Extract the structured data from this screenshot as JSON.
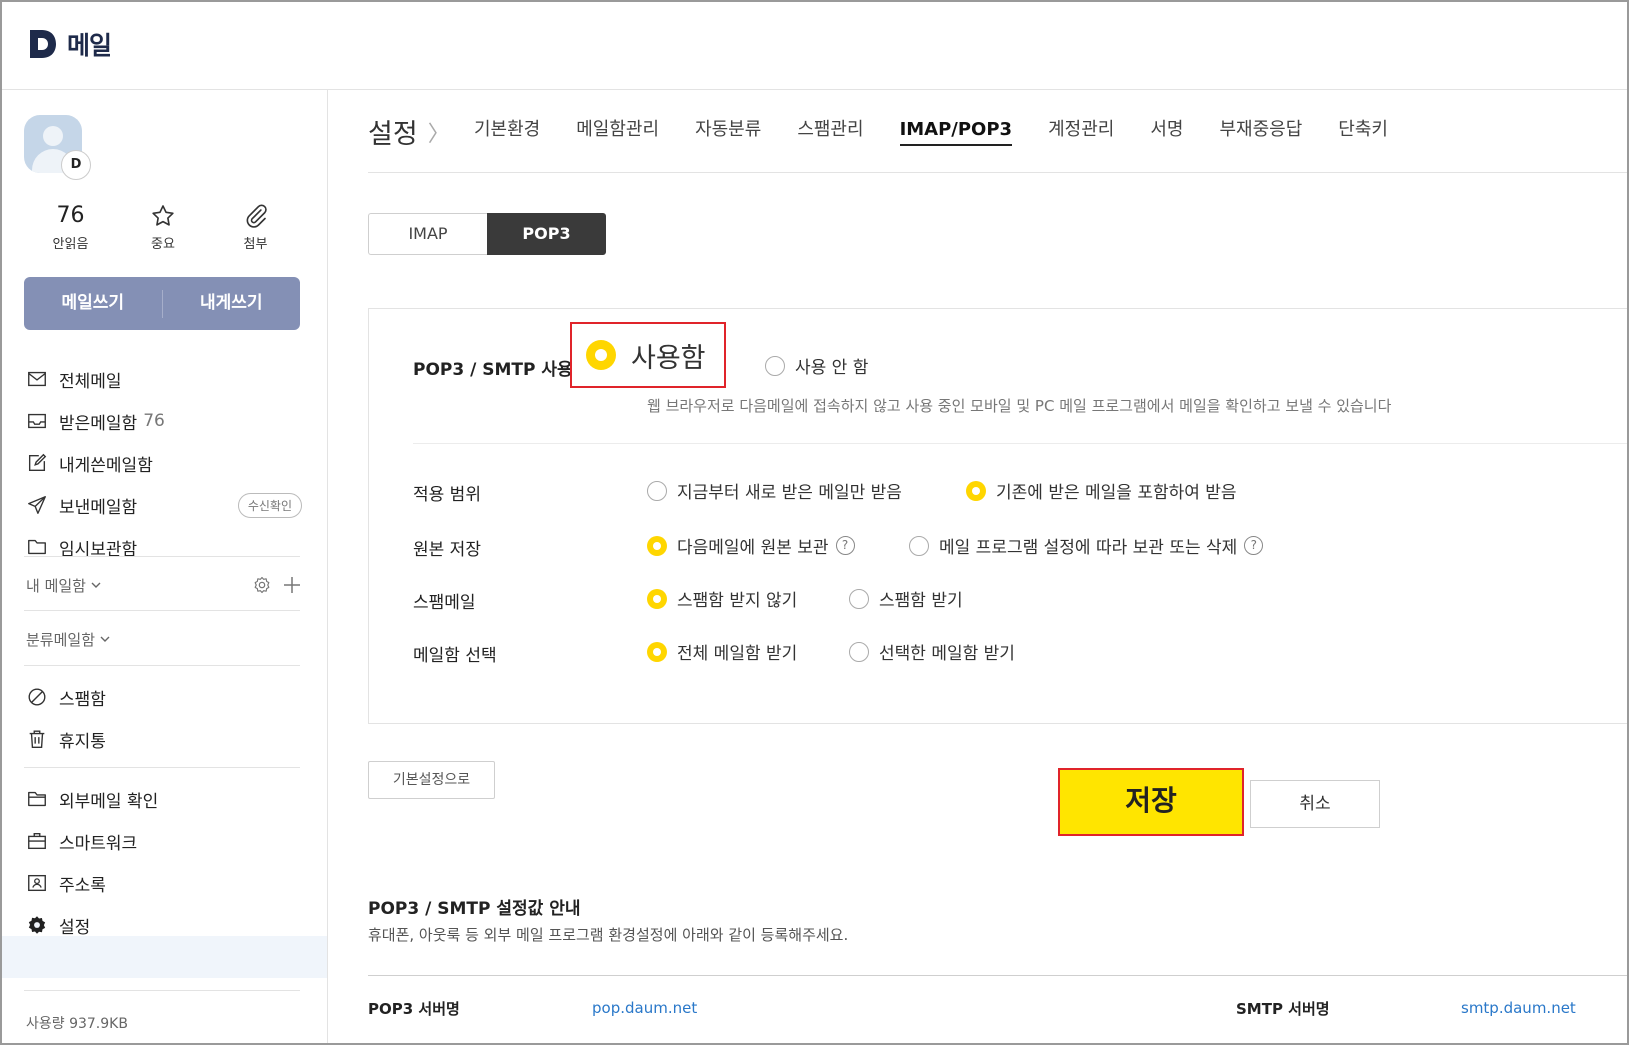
{
  "header": {
    "logo_letter": "D",
    "title": "메일"
  },
  "sidebar": {
    "avatar_badge": "D",
    "counts": [
      {
        "value": "76",
        "label": "안읽음"
      },
      {
        "label": "중요"
      },
      {
        "label": "첨부"
      }
    ],
    "write_label": "메일쓰기",
    "self_write_label": "내게쓰기",
    "mailboxes": [
      {
        "label": "전체메일",
        "icon": "mail-icon"
      },
      {
        "label": "받은메일함",
        "count": "76",
        "icon": "inbox-icon"
      },
      {
        "label": "내게쓴메일함",
        "icon": "self-write-icon"
      },
      {
        "label": "보낸메일함",
        "badge": "수신확인",
        "icon": "send-icon"
      },
      {
        "label": "임시보관함",
        "icon": "folder-icon"
      }
    ],
    "my_mailbox_label": "내 메일함",
    "category_mailbox_label": "분류메일함",
    "trash_group": [
      {
        "label": "스팸함",
        "icon": "block-icon"
      },
      {
        "label": "휴지통",
        "icon": "trash-icon"
      }
    ],
    "tools": [
      {
        "label": "외부메일 확인",
        "icon": "external-folder-icon"
      },
      {
        "label": "스마트워크",
        "icon": "briefcase-icon"
      },
      {
        "label": "주소록",
        "icon": "address-book-icon"
      },
      {
        "label": "설정",
        "icon": "gear-icon"
      }
    ],
    "usage": "사용량 937.9KB"
  },
  "main": {
    "breadcrumb": "설정",
    "tabs": [
      "기본환경",
      "메일함관리",
      "자동분류",
      "스팸관리",
      "IMAP/POP3",
      "계정관리",
      "서명",
      "부재중응답",
      "단축키"
    ],
    "active_tab": "IMAP/POP3",
    "segments": [
      "IMAP",
      "POP3"
    ],
    "active_segment": "POP3",
    "form": {
      "use_label": "POP3 / SMTP 사용",
      "use_on": "사용함",
      "use_off": "사용 안 함",
      "use_desc": "웹 브라우저로 다음메일에 접속하지 않고 사용 중인 모바일 및 PC 메일 프로그램에서 메일을 확인하고 보낼 수 있습니다",
      "scope_label": "적용 범위",
      "scope_opt1": "지금부터 새로 받은 메일만 받음",
      "scope_opt2": "기존에 받은 메일을 포함하여 받음",
      "origin_label": "원본 저장",
      "origin_opt1": "다음메일에 원본 보관",
      "origin_opt2": "메일 프로그램 설정에 따라 보관 또는 삭제",
      "help_mark": "?",
      "spam_label": "스팸메일",
      "spam_opt1": "스팸함 받지 않기",
      "spam_opt2": "스팸함 받기",
      "mailbox_label": "메일함 선택",
      "mailbox_opt1": "전체 메일함 받기",
      "mailbox_opt2": "선택한 메일함 받기"
    },
    "buttons": {
      "reset": "기본설정으로",
      "save": "저장",
      "cancel": "취소"
    },
    "info": {
      "title": "POP3 / SMTP 설정값 안내",
      "desc": "휴대폰, 아웃룩 등 외부 메일 프로그램 환경설정에 아래와 같이 등록해주세요.",
      "pop3_label": "POP3 서버명",
      "pop3_value": "pop.daum.net",
      "smtp_label": "SMTP 서버명",
      "smtp_value": "smtp.daum.net"
    }
  },
  "colors": {
    "accent_yellow": "#ffd600",
    "save_yellow": "#ffe500",
    "highlight_red": "#e0242a",
    "write_btn": "#8490b5",
    "link_blue": "#2a78c9"
  }
}
